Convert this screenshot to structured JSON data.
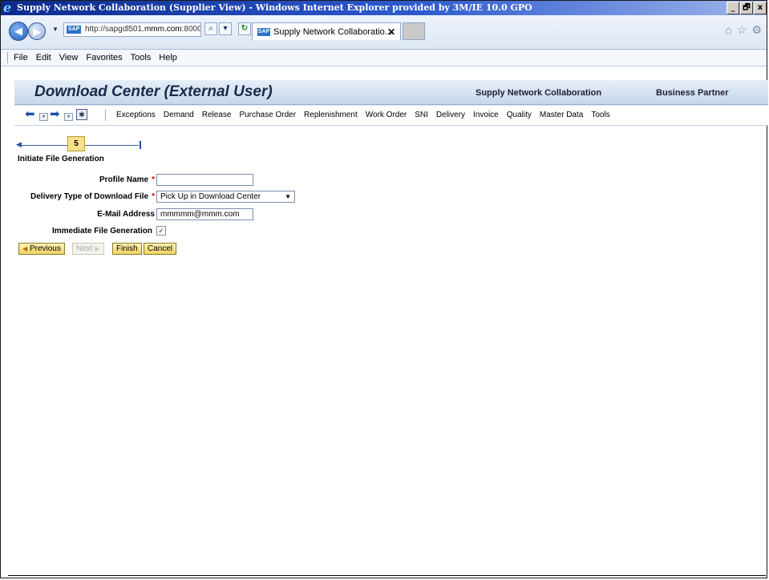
{
  "window": {
    "title": "Supply Network Collaboration (Supplier View) - Windows Internet Explorer provided by 3M/IE 10.0 GPO",
    "controls": [
      "_",
      "🗗",
      "x"
    ]
  },
  "browser": {
    "url_prefix": "http://sapgdl501.",
    "url_domain": "mmm.com",
    "url_suffix": ":8000,",
    "tab_title": "Supply Network Collaboratio...",
    "menu": [
      "File",
      "Edit",
      "View",
      "Favorites",
      "Tools",
      "Help"
    ]
  },
  "sap": {
    "page_title": "Download Center (External User)",
    "header_links": [
      "Supply Network Collaboration",
      "Business Partner"
    ],
    "nav_menu": [
      "Exceptions",
      "Demand",
      "Release",
      "Purchase Order",
      "Replenishment",
      "Work Order",
      "SNI",
      "Delivery",
      "Invoice",
      "Quality",
      "Master Data",
      "Tools"
    ]
  },
  "roadmap": {
    "step_number": "5",
    "step_label": "Initiate File Generation"
  },
  "form": {
    "profile_name_label": "Profile Name",
    "profile_name_value": "",
    "delivery_type_label": "Delivery Type of Download File",
    "delivery_type_value": "Pick Up in Download Center",
    "email_label": "E-Mail Address",
    "email_value": "mmmmm@mmm.com",
    "immediate_label": "Immediate File Generation",
    "immediate_checked": true,
    "required_mark": "*"
  },
  "buttons": {
    "previous": "Previous",
    "next": "Next",
    "finish": "Finish",
    "cancel": "Cancel"
  }
}
